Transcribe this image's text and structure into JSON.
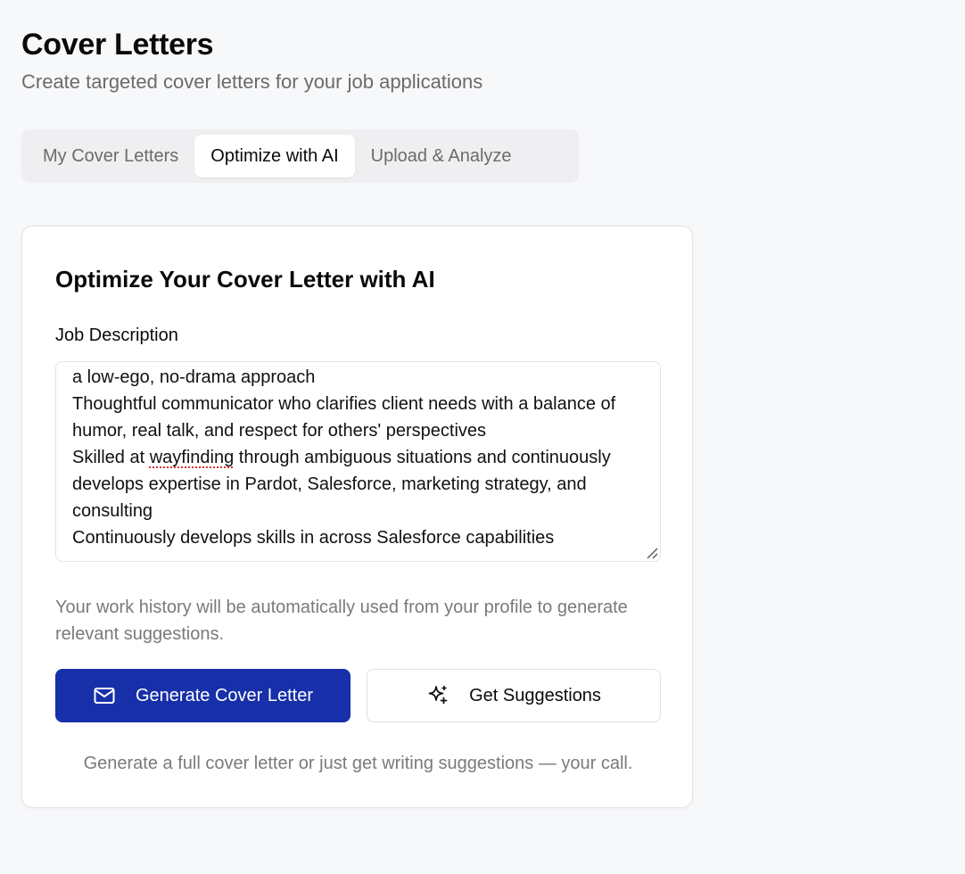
{
  "header": {
    "title": "Cover Letters",
    "subtitle": "Create targeted cover letters for your job applications"
  },
  "tabs": [
    {
      "label": "My Cover Letters",
      "active": false
    },
    {
      "label": "Optimize with AI",
      "active": true
    },
    {
      "label": "Upload & Analyze",
      "active": false
    }
  ],
  "card": {
    "title": "Optimize Your Cover Letter with AI",
    "job_description_label": "Job Description",
    "job_description": {
      "line1": "a low-ego, no-drama approach",
      "line2": "Thoughtful communicator who clarifies client needs with a balance of humor, real talk, and respect for others' perspectives",
      "line3_before": "Skilled at ",
      "line3_flagged": "wayfinding",
      "line3_after": " through ambiguous situations and continuously develops expertise in Pardot, Salesforce, marketing strategy, and consulting",
      "line4": "Continuously develops skills in across Salesforce capabilities"
    },
    "help_text": "Your work history will be automatically used from your profile to generate relevant suggestions.",
    "generate_button": "Generate Cover Letter",
    "suggestions_button": "Get Suggestions",
    "footer_note": "Generate a full cover letter or just get writing suggestions — your call."
  },
  "colors": {
    "primary": "#1730a9",
    "background": "#f7f8fa",
    "muted_text": "#7a7a7a"
  },
  "icons": {
    "generate": "mail-icon",
    "suggestions": "sparkles-icon"
  }
}
